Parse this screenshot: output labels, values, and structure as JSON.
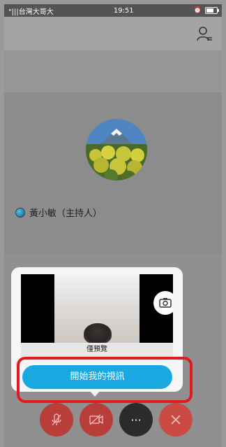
{
  "status_bar": {
    "carrier": "\"|||台灣大哥大",
    "time": "19:51"
  },
  "participant": {
    "name_label": "黃小敏（主持人）"
  },
  "video_preview": {
    "name_label": "僅預覽"
  },
  "popup": {
    "start_video_button": "開始我的視訊"
  },
  "controls": {
    "more_label": "···"
  },
  "colors": {
    "accent": "#19a8e0",
    "highlight": "#e3191e",
    "control_red": "#b83e3a",
    "control_dark": "#2b2b2b"
  },
  "icons": [
    "profile-list-icon",
    "camera-switch-icon",
    "mic-off-icon",
    "video-off-icon",
    "more-icon",
    "close-icon"
  ]
}
